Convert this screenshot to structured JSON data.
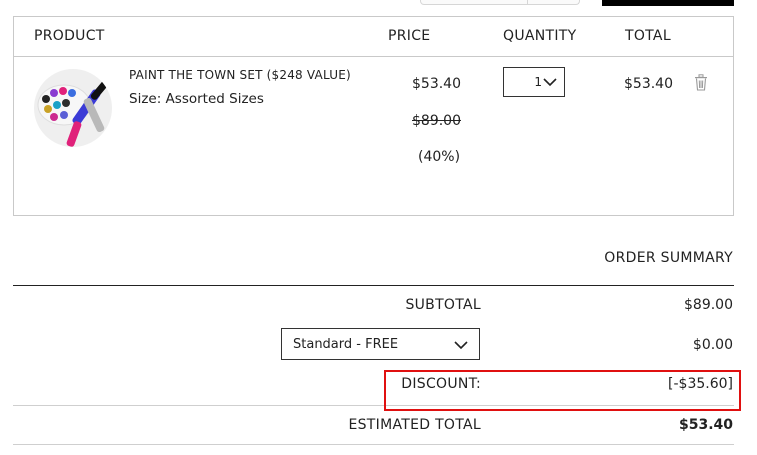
{
  "headers": {
    "product": "PRODUCT",
    "price": "PRICE",
    "quantity": "QUANTITY",
    "total": "TOTAL"
  },
  "item": {
    "name": "PAINT THE TOWN SET ($248 VALUE)",
    "size": "Size: Assorted Sizes",
    "price": "$53.40",
    "original_price": "$89.00",
    "discount_percent": "(40%)",
    "quantity": "1",
    "total": "$53.40",
    "icons": [
      "trash-icon",
      "chevron-down-icon"
    ]
  },
  "summary": {
    "title": "ORDER SUMMARY",
    "subtotal_label": "SUBTOTAL",
    "subtotal_value": "$89.00",
    "shipping_option": "Standard - FREE",
    "shipping_value": "$0.00",
    "discount_label": "DISCOUNT:",
    "discount_value": "[-$35.60]",
    "estimated_total_label": "ESTIMATED TOTAL",
    "estimated_total_value": "$53.40"
  },
  "colors": {
    "highlight": "#e01010",
    "border": "#c9c9c9",
    "text": "#222222"
  }
}
